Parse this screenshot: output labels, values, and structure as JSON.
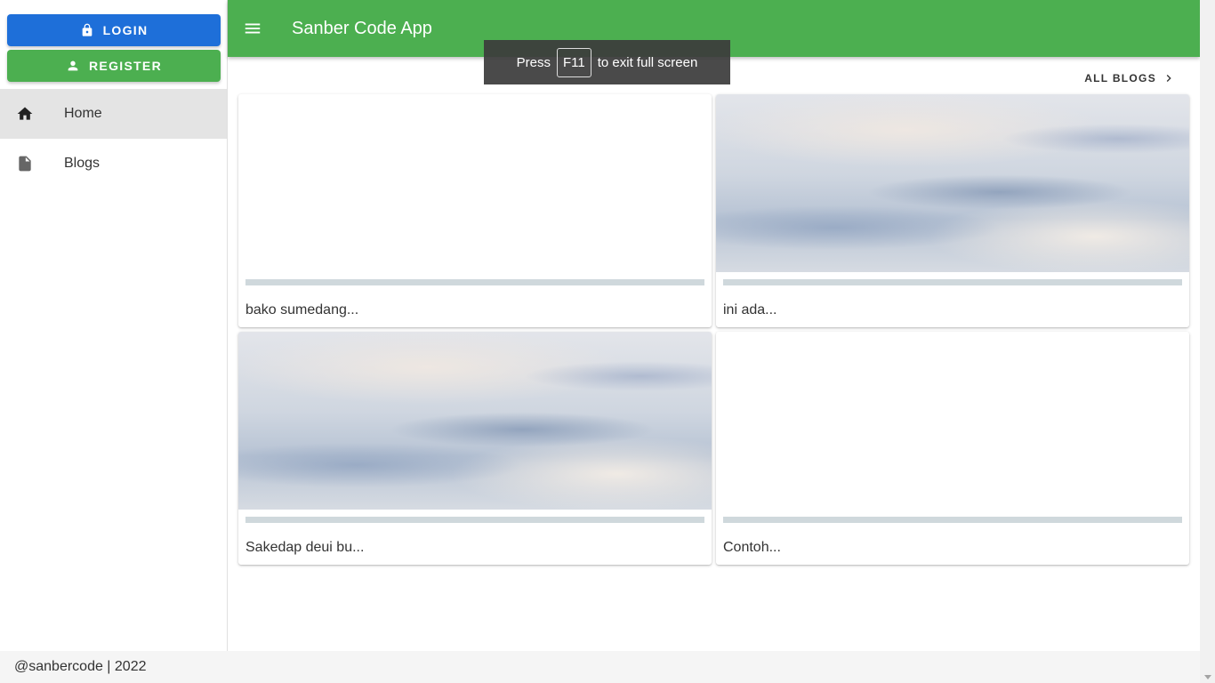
{
  "colors": {
    "login_blue": "#1e6fd9",
    "register_green": "#4caf50",
    "appbar_green": "#4caf50"
  },
  "sidebar": {
    "login_label": "LOGIN",
    "login_icon": "lock-icon",
    "register_label": "REGISTER",
    "register_icon": "person-icon",
    "nav_items": [
      {
        "label": "Home",
        "icon": "home-icon",
        "active": true
      },
      {
        "label": "Blogs",
        "icon": "document-icon",
        "active": false
      }
    ]
  },
  "appbar": {
    "title": "Sanber Code App",
    "menu_icon": "menu-icon"
  },
  "fullscreen_notice": {
    "before": "Press",
    "key": "F11",
    "after": "to exit full screen"
  },
  "main": {
    "all_blogs_label": "ALL BLOGS",
    "cards": [
      {
        "title": "bako sumedang...",
        "has_image": false
      },
      {
        "title": "ini ada...",
        "has_image": true
      },
      {
        "title": "Sakedap deui bu...",
        "has_image": true
      },
      {
        "title": "Contoh...",
        "has_image": false
      }
    ]
  },
  "footer": {
    "text": "@sanbercode | 2022"
  }
}
